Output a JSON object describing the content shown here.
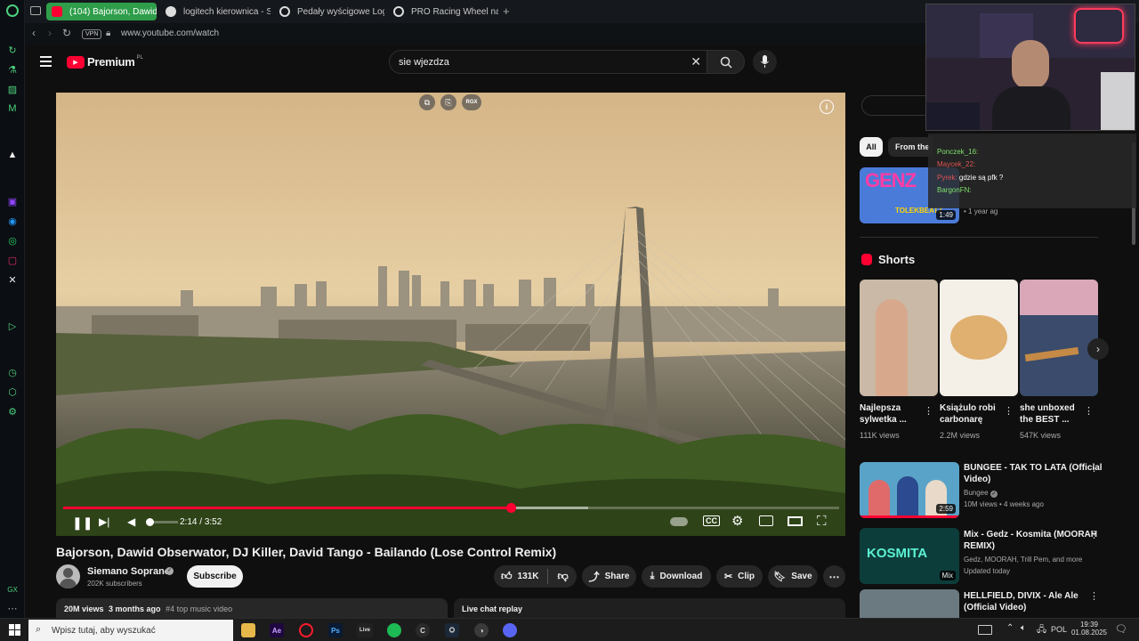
{
  "browser": {
    "tabs": [
      {
        "label": "(104) Bajorson, Dawid",
        "active": true
      },
      {
        "label": "logitech kierownica - Szu",
        "active": false
      },
      {
        "label": "Pedały wyścigowe Logite",
        "active": false
      },
      {
        "label": "PRO Racing Wheel na Pla",
        "active": false
      }
    ],
    "vpn_label": "VPN",
    "url": "www.youtube.com/watch"
  },
  "youtube": {
    "logo_text": "Premium",
    "logo_region": "PL",
    "search_value": "sie wjezdza"
  },
  "player": {
    "overlay_badge": "RGX",
    "time_current": "2:14",
    "time_sep": "/",
    "time_total": "3:52",
    "progress_fraction": 0.577,
    "buffer_fraction": 0.677,
    "volume_fraction": 0.05
  },
  "video": {
    "title": "Bajorson, Dawid Obserwator, DJ Killer, David Tango - Bailando (Lose Control Remix)",
    "channel": "Siemano Soprano",
    "subscribers": "202K subscribers",
    "subscribe_label": "Subscribe",
    "likes": "131K",
    "share_label": "Share",
    "download_label": "Download",
    "clip_label": "Clip",
    "save_label": "Save",
    "views": "20M views",
    "uploaded": "3 months ago",
    "hashtag": "#4 top music video",
    "live_chat_label": "Live chat replay"
  },
  "sidebar": {
    "chips": [
      "All",
      "From the"
    ],
    "first_video": {
      "thumb_text": "GENZ",
      "thumb_sub": "TOLEKBEATZ",
      "duration": "1:49",
      "meta": "• 1 year ag"
    },
    "shorts_heading": "Shorts",
    "shorts": [
      {
        "title_l1": "Najlepsza",
        "title_l2": "sylwetka ...",
        "views": "111K views"
      },
      {
        "title_l1": "Książulo robi",
        "title_l2": "carbonarę",
        "views": "2.2M views"
      },
      {
        "title_l1": "she unboxed",
        "title_l2": "the BEST ...",
        "views": "547K views"
      }
    ],
    "videos": [
      {
        "title_l1": "BUNGEE - TAK TO LATA (Official",
        "title_l2": "Video)",
        "channel": "Bungee",
        "meta": "10M views • 4 weeks ago",
        "duration": "2:59",
        "thumb_text": ""
      },
      {
        "title_l1": "Mix - Gedz - Kosmita (MOORAH",
        "title_l2": "REMIX)",
        "channel": "Gedz, MOORAH, Trill Pem, and more",
        "meta": "Updated today",
        "duration": "Mix",
        "thumb_text": "KOSMITA"
      },
      {
        "title_l1": "HELLFIELD, DIVIX - Ale Ale",
        "title_l2": "(Official Video)",
        "channel": "",
        "meta": "",
        "duration": "",
        "thumb_text": ""
      }
    ]
  },
  "stream_chat": [
    {
      "user": "Ponczek_16:",
      "msg": "",
      "color": "#7ee06b"
    },
    {
      "user": "Maycek_22:",
      "msg": "",
      "color": "#e05454"
    },
    {
      "user": "Pyrek:",
      "msg": "gdzie są pfk ?",
      "color": "#e05454"
    },
    {
      "user": "BargonFN:",
      "msg": "",
      "color": "#7ee06b"
    }
  ],
  "taskbar": {
    "search_placeholder": "Wpisz tutaj, aby wyszukać",
    "lang": "POL",
    "time": "19:39",
    "date": "01.08.2025",
    "apps": [
      "Ae",
      "Ps",
      "Live"
    ]
  },
  "colors": {
    "accent": "#ff0033",
    "tab_active": "#2f9e4a"
  }
}
